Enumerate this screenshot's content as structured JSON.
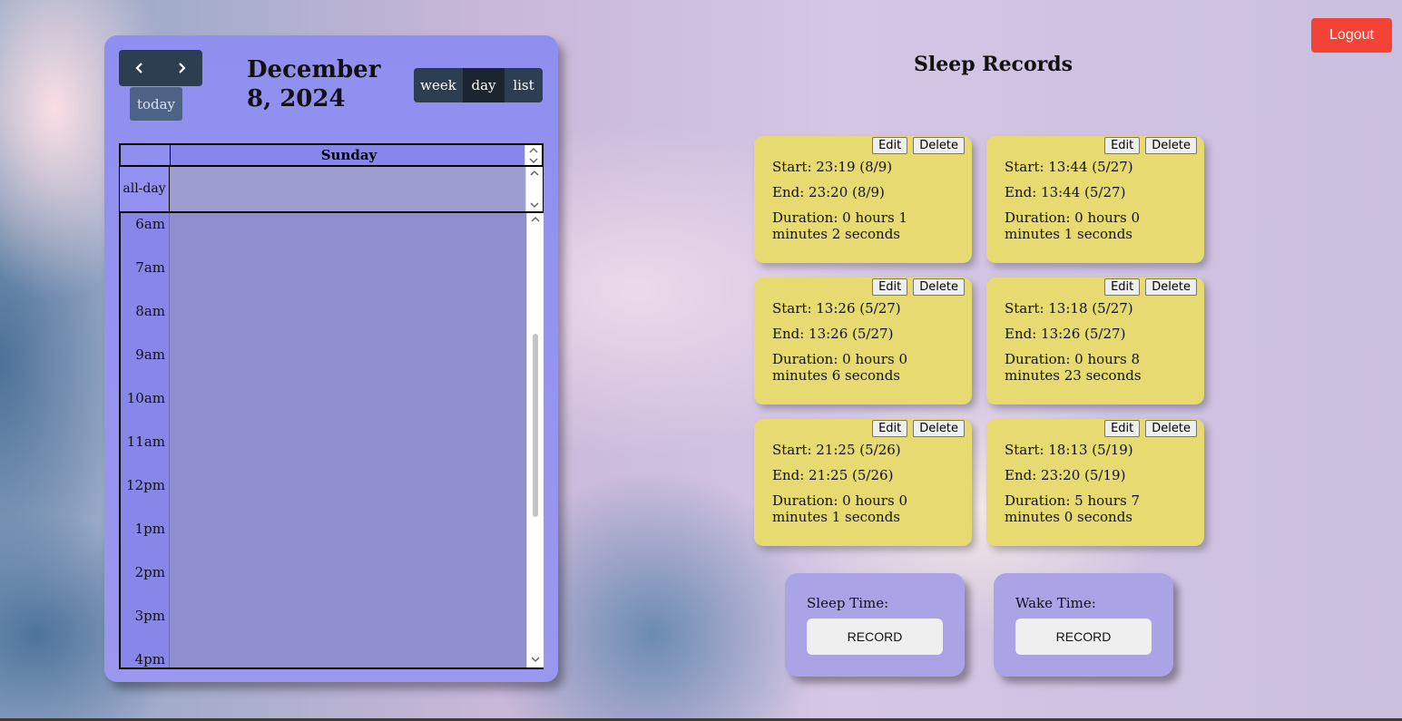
{
  "header": {
    "logout_label": "Logout"
  },
  "calendar": {
    "title": "December 8, 2024",
    "today_label": "today",
    "views": [
      "week",
      "day",
      "list"
    ],
    "active_view": "day",
    "day_header": "Sunday",
    "allday_label": "all-day",
    "time_labels": [
      "6am",
      "7am",
      "8am",
      "9am",
      "10am",
      "11am",
      "12pm",
      "1pm",
      "2pm",
      "3pm",
      "4pm"
    ]
  },
  "records": {
    "title": "Sleep Records",
    "edit_label": "Edit",
    "delete_label": "Delete",
    "items": [
      {
        "start": "Start: 23:19 (8/9)",
        "end": "End: 23:20 (8/9)",
        "duration": "Duration: 0 hours 1 minutes 2 seconds"
      },
      {
        "start": "Start: 13:44 (5/27)",
        "end": "End: 13:44 (5/27)",
        "duration": "Duration: 0 hours 0 minutes 1 seconds"
      },
      {
        "start": "Start: 13:26 (5/27)",
        "end": "End: 13:26 (5/27)",
        "duration": "Duration: 0 hours 0 minutes 6 seconds"
      },
      {
        "start": "Start: 13:18 (5/27)",
        "end": "End: 13:26 (5/27)",
        "duration": "Duration: 0 hours 8 minutes 23 seconds"
      },
      {
        "start": "Start: 21:25 (5/26)",
        "end": "End: 21:25 (5/26)",
        "duration": "Duration: 0 hours 0 minutes 1 seconds"
      },
      {
        "start": "Start: 18:13 (5/19)",
        "end": "End: 23:20 (5/19)",
        "duration": "Duration: 5 hours 7 minutes 0 seconds"
      }
    ]
  },
  "recorders": {
    "sleep_label": "Sleep Time:",
    "wake_label": "Wake Time:",
    "record_label": "RECORD"
  },
  "colors": {
    "accent_logout": "#f44336",
    "card_yellow": "#e6da70",
    "calendar_bg": "#8f8ff0",
    "button_dark": "#2c3e50"
  }
}
